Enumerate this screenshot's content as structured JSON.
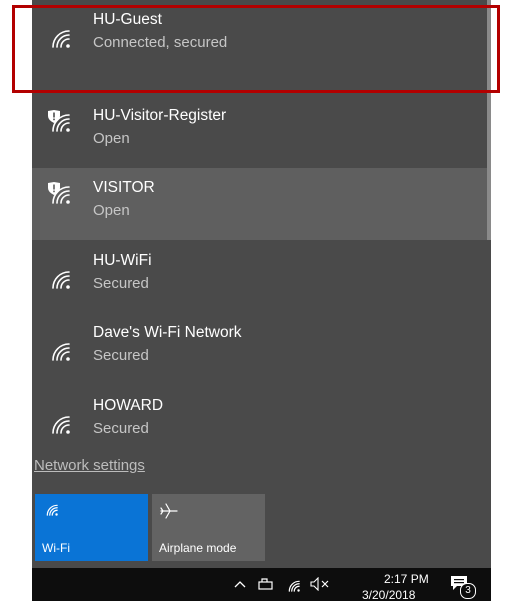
{
  "networks": [
    {
      "name": "HU-Guest",
      "status": "Connected, secured",
      "icon": "wifi-icon"
    },
    {
      "name": "HU-Visitor-Register",
      "status": "Open",
      "icon": "wifi-shield-warning-icon"
    },
    {
      "name": "VISITOR",
      "status": "Open",
      "icon": "wifi-shield-warning-icon"
    },
    {
      "name": "HU-WiFi",
      "status": "Secured",
      "icon": "wifi-icon"
    },
    {
      "name": "Dave's Wi-Fi Network",
      "status": "Secured",
      "icon": "wifi-icon"
    },
    {
      "name": "HOWARD",
      "status": "Secured",
      "icon": "wifi-icon"
    }
  ],
  "network_settings_link": "Network settings",
  "quick_actions": {
    "wifi_label": "Wi-Fi",
    "airplane_label": "Airplane mode"
  },
  "taskbar": {
    "time": "2:17 PM",
    "date": "3/20/2018",
    "notification_count": "3"
  },
  "colors": {
    "flyout_bg": "#4a4a4a",
    "accent_blue": "#0a74d6",
    "highlight_box": "#b30000"
  }
}
